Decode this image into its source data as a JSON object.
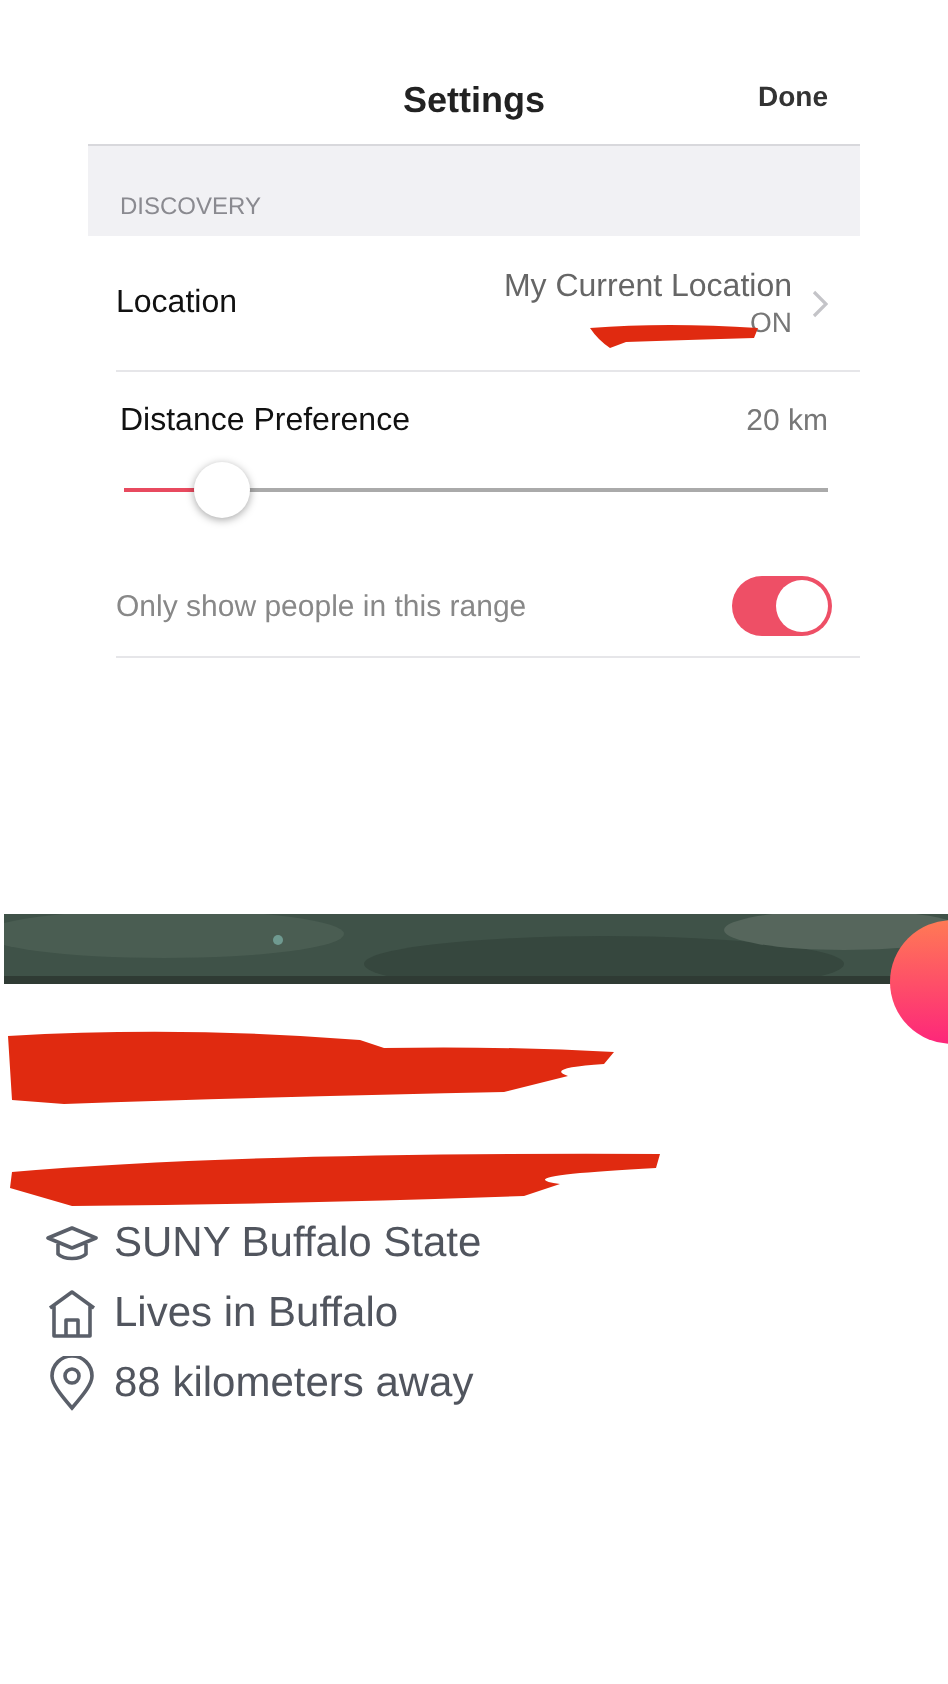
{
  "settings": {
    "title": "Settings",
    "done": "Done",
    "section": "DISCOVERY",
    "location": {
      "label": "Location",
      "value": "My Current Location",
      "status": "ON"
    },
    "distance": {
      "label": "Distance Preference",
      "reading": "20 km",
      "level": 0.14
    },
    "range_toggle": {
      "label": "Only show people in this range",
      "on": true
    }
  },
  "profile": {
    "details": [
      {
        "kind": "school",
        "text": "SUNY Buffalo State"
      },
      {
        "kind": "home",
        "text": "Lives in Buffalo"
      },
      {
        "kind": "distance",
        "text": "88 kilometers away"
      }
    ]
  }
}
